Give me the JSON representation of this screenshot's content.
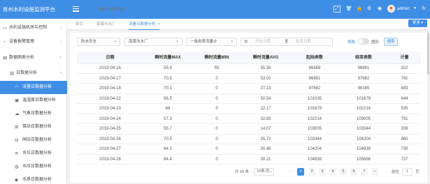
{
  "header": {
    "app_title": "贵州水利设施监测平台",
    "search_placeholder": "请输入搜索内容",
    "user_name": "admin"
  },
  "icons": {
    "menu": "hamburger-icon",
    "fullscreen": "fullscreen-icon",
    "skin": "tshirt-icon",
    "lock": "lock-icon",
    "settings": "gear-icon",
    "eye": "eye-icon",
    "refresh": "refresh-icon"
  },
  "sidebar": {
    "items": [
      {
        "label": "水利设施机房与控制",
        "icon": "monitor-icon"
      },
      {
        "label": "设备报警管理",
        "icon": "alarm-icon"
      },
      {
        "label": "数据图表分析",
        "icon": "chart-icon"
      },
      {
        "label": "日数据分析",
        "icon": "bar-chart-icon"
      },
      {
        "label": "流量日数据分析",
        "icon": "gauge-icon"
      },
      {
        "label": "温湿度日数据分析",
        "icon": "thermometer-icon"
      },
      {
        "label": "气象日数据分析",
        "icon": "cloud-icon"
      },
      {
        "label": "泵站日数据分析",
        "icon": "pump-icon"
      },
      {
        "label": "闸站日数据分析",
        "icon": "gate-icon"
      },
      {
        "label": "水位日数据分析",
        "icon": "water-level-icon"
      },
      {
        "label": "水压日数据分析",
        "icon": "pressure-icon"
      },
      {
        "label": "水质日数据分析",
        "icon": "water-drop-icon"
      }
    ]
  },
  "tabs": [
    {
      "label": "首页"
    },
    {
      "label": "南黄沟水厂"
    },
    {
      "label": "流量日数据分析",
      "close": "×"
    }
  ],
  "more_button": "更多",
  "filters": {
    "category": "防水安全",
    "plant": "南黄沟水厂",
    "meter": "一级用表流量计",
    "date_start": "开始日期",
    "date_to": "至",
    "date_end": "结束日期",
    "table_label": "表格",
    "chart_label": "图形",
    "search_button": "搜索"
  },
  "table": {
    "columns": [
      "日期",
      "瞬时流量MAX",
      "瞬时流量MIN",
      "瞬时流量AVG",
      "起始表数",
      "结束表数",
      "计量"
    ],
    "rows": [
      [
        "2019-04-16",
        "55.9",
        "55",
        "55.39",
        "96569",
        "96891",
        "322"
      ],
      [
        "2019-04-17",
        "70.5",
        "0",
        "53.02",
        "96891",
        "97682",
        "791"
      ],
      [
        "2019-04-18",
        "70.1",
        "0",
        "27.13",
        "97682",
        "98165",
        "483"
      ],
      [
        "2019-04-22",
        "56.5",
        "0",
        "50.54",
        "101035",
        "101679",
        "644"
      ],
      [
        "2019-04-23",
        "68",
        "0",
        "22.17",
        "101679",
        "102214",
        "535"
      ],
      [
        "2019-04-24",
        "57.3",
        "0",
        "32.83",
        "102214",
        "103005",
        "791"
      ],
      [
        "2019-04-25",
        "55.7",
        "0",
        "14.07",
        "103005",
        "103344",
        "339"
      ],
      [
        "2019-04-26",
        "70.5",
        "0",
        "35.72",
        "103344",
        "104204",
        "860"
      ],
      [
        "2019-04-27",
        "64.1",
        "0",
        "30.49",
        "104204",
        "104939",
        "735"
      ],
      [
        "2019-04-28",
        "64.4",
        "0",
        "30.21",
        "104939",
        "105666",
        "727"
      ]
    ]
  },
  "pagination": {
    "total": "共 68 条",
    "page_size": "10条/页",
    "prev": "‹",
    "pages": [
      "1",
      "2",
      "3",
      "4",
      "5",
      "6",
      "7"
    ],
    "next": "›",
    "goto_label": "前往",
    "current": "1",
    "page_suffix": "页"
  },
  "colors": {
    "primary": "#3f8ee6",
    "header_bg": "#3f8ee6",
    "table_header_bg": "#f5f7fa"
  }
}
